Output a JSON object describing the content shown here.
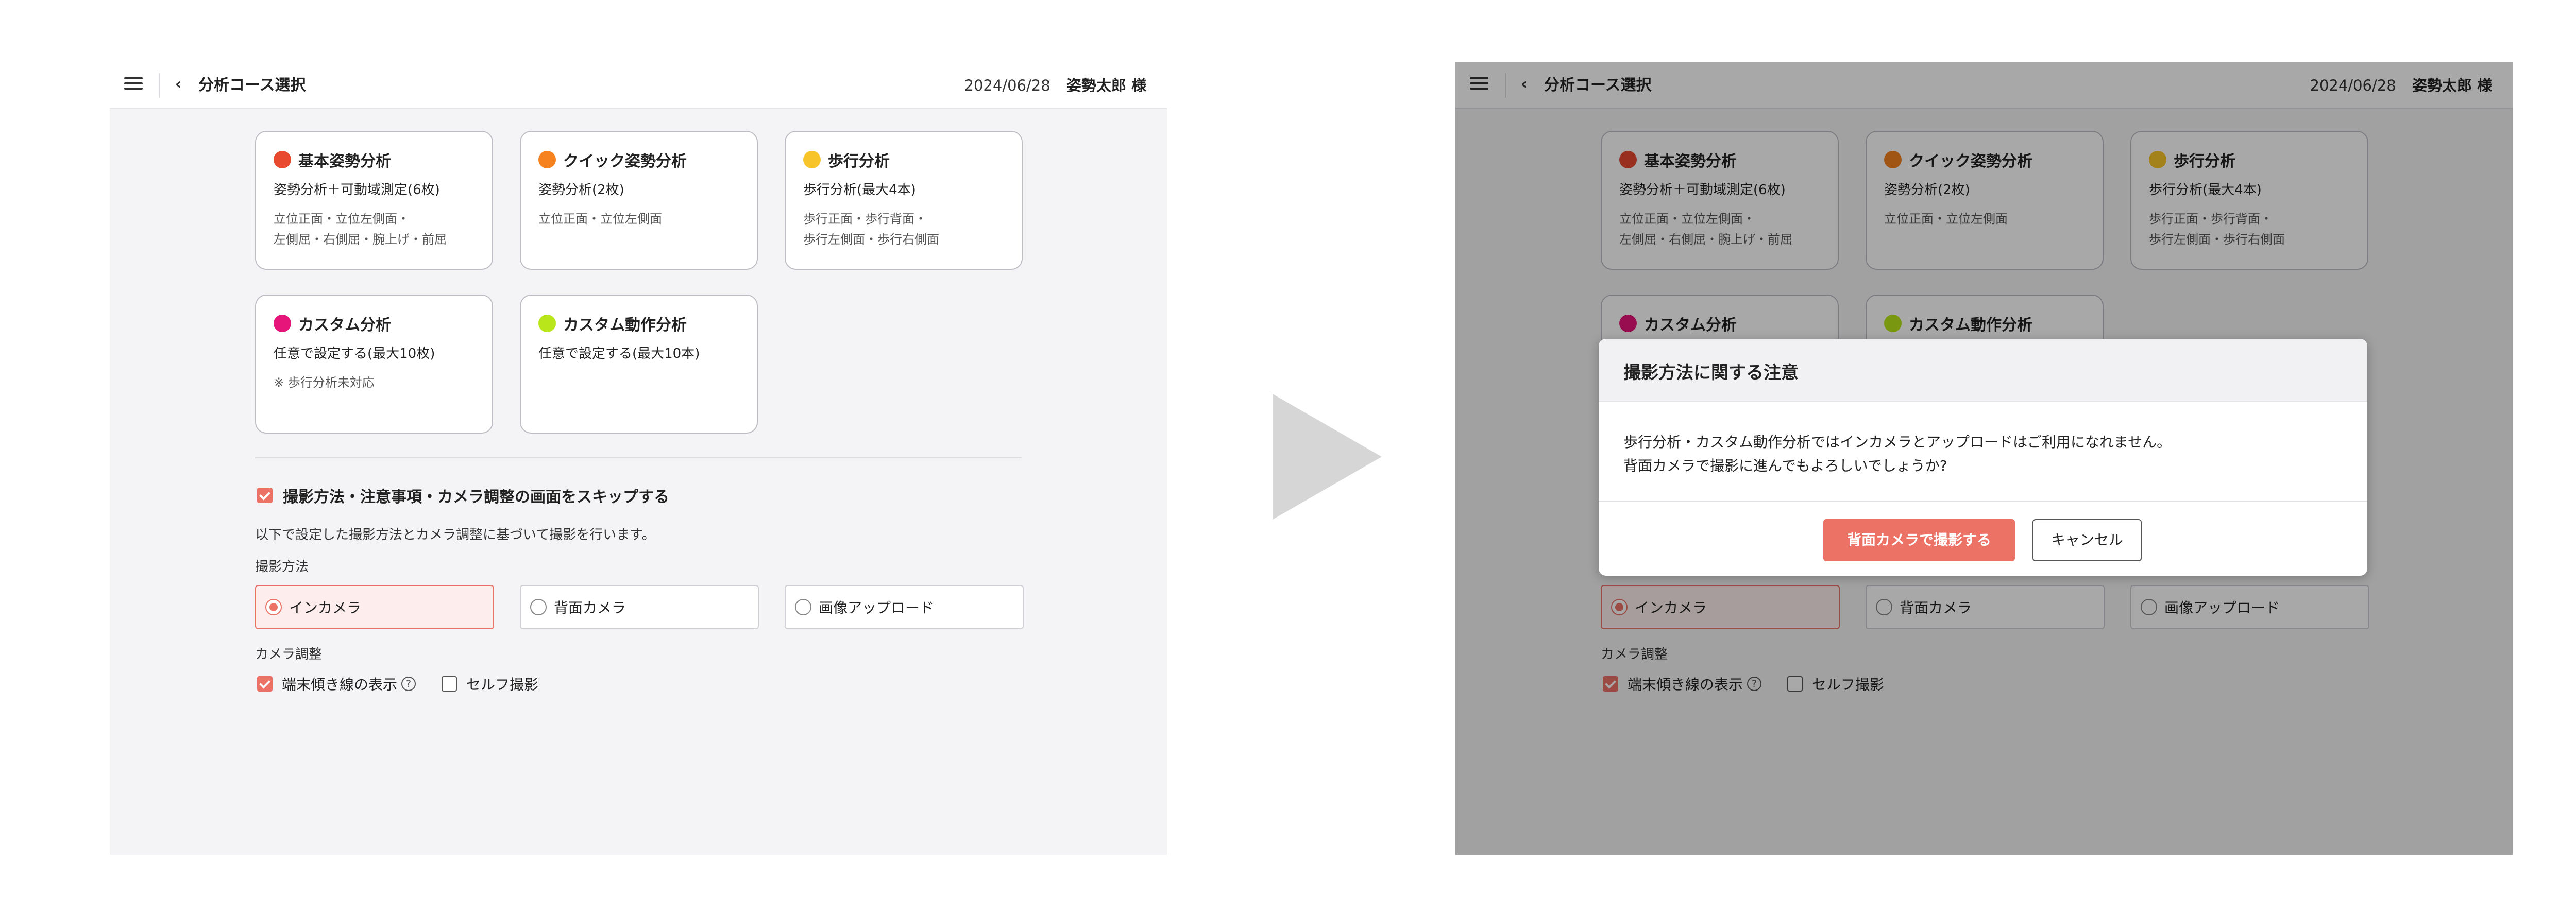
{
  "header": {
    "title": "分析コース選択",
    "date": "2024/06/28",
    "user": "姿勢太郎 様"
  },
  "courses": [
    {
      "name": "基本姿勢分析",
      "dot_color": "#e84a2f",
      "summary": "姿勢分析＋可動域測定(6枚)",
      "detail_1": "立位正面・立位左側面・",
      "detail_2": "左側屈・右側屈・腕上げ・前屈"
    },
    {
      "name": "クイック姿勢分析",
      "dot_color": "#f5821f",
      "summary": "姿勢分析(2枚)",
      "detail_1": "立位正面・立位左側面",
      "detail_2": ""
    },
    {
      "name": "歩行分析",
      "dot_color": "#f7c52a",
      "summary": "歩行分析(最大4本)",
      "detail_1": "歩行正面・歩行背面・",
      "detail_2": "歩行左側面・歩行右側面"
    },
    {
      "name": "カスタム分析",
      "dot_color": "#e5157a",
      "summary": "任意で設定する(最大10枚)",
      "detail_1": "※ 歩行分析未対応",
      "detail_2": ""
    },
    {
      "name": "カスタム動作分析",
      "dot_color": "#b9e61a",
      "summary": "任意で設定する(最大10本)",
      "detail_1": "",
      "detail_2": ""
    }
  ],
  "skip": {
    "label": "撮影方法・注意事項・カメラ調整の画面をスキップする",
    "checked": true,
    "description": "以下で設定した撮影方法とカメラ調整に基づいて撮影を行います。"
  },
  "shooting": {
    "label": "撮影方法",
    "options": [
      "インカメラ",
      "背面カメラ",
      "画像アップロード"
    ],
    "selected": "インカメラ"
  },
  "camera": {
    "label": "カメラ調整",
    "tilt_label": "端末傾き線の表示",
    "tilt_checked": true,
    "self_label": "セルフ撮影",
    "self_checked": false
  },
  "dialog": {
    "title": "撮影方法に関する注意",
    "line1": "歩行分析・カスタム動作分析ではインカメラとアップロードはご利用になれません。",
    "line2": "背面カメラで撮影に進んでもよろしいでしょうか?",
    "confirm": "背面カメラで撮影する",
    "cancel": "キャンセル"
  },
  "colors": {
    "accent": "#ec7266",
    "arrow": "#d6d6d6"
  },
  "icons": [
    "menu-icon",
    "chevron-left-icon",
    "checkbox-icon",
    "radio-icon",
    "help-icon",
    "arrow-right-icon"
  ]
}
